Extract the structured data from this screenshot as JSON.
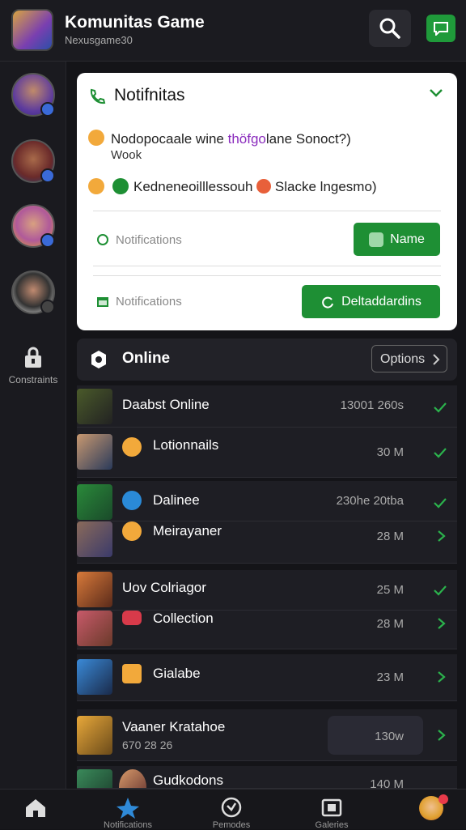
{
  "header": {
    "title": "Komunitas Game",
    "subtitle": "Nexusgame30"
  },
  "sidebar": {
    "label": "Constraints"
  },
  "notifications": {
    "title": "Notifnitas",
    "line1_pre": "Nodopocaale wine",
    "line1_hl": "thöfgo",
    "line1_post": "lane Sonoct?)",
    "line1_sub": "Wook",
    "line2": "Kedneneoilllessouh",
    "line2_post": "Slacke lngesmo)",
    "row1_label": "Notifications",
    "row1_button": "Name",
    "row2_label": "Notifications",
    "row2_button": "Deltaddardins"
  },
  "online": {
    "title": "Online",
    "button": "Options"
  },
  "list": [
    {
      "name": "Daabst Online",
      "meta": "13001 260s"
    },
    {
      "name": "Lotionnails",
      "meta": "30 M"
    },
    {
      "name": "Dalinee",
      "meta": "230he 20tba"
    },
    {
      "name": "Meirayaner",
      "meta": "28 M"
    },
    {
      "name": "Uov Colriagor",
      "meta": "25 M"
    },
    {
      "name": "Collection",
      "meta": "28 M"
    },
    {
      "name": "Gialabe",
      "meta": "23 M"
    },
    {
      "name": "Vaaner Kratahoe",
      "sub": "670 28 26",
      "meta": "130w"
    },
    {
      "name": "Gudkodons",
      "meta": "140 M"
    }
  ],
  "nav": {
    "item1": "",
    "item2": "Notifications",
    "item3": "Pemodes",
    "item4": "Galeries"
  },
  "colors": {
    "accent": "#1e8f34",
    "bg": "#141418",
    "card": "#ffffff"
  }
}
